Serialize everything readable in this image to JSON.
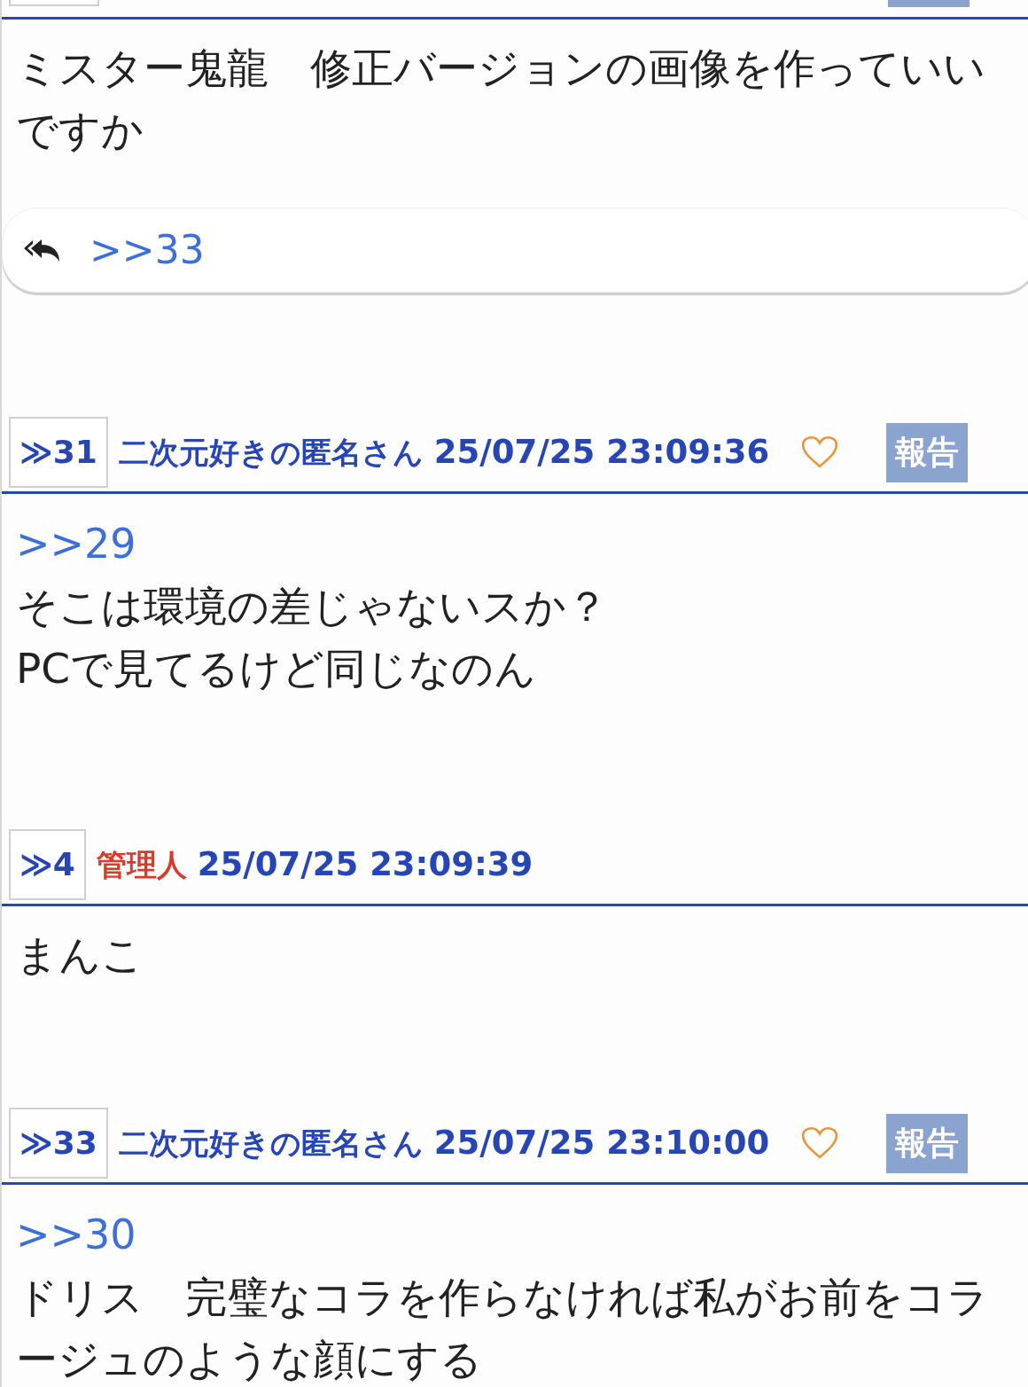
{
  "posts": [
    {
      "text": "ミスター鬼龍　修正バージョンの画像を作っていいですか",
      "reply": {
        "anchor": ">>33"
      }
    },
    {
      "header": {
        "number": "≫31",
        "author": "二次元好きの匿名さん",
        "admin": false,
        "date": "25/07/25 23:09:36",
        "heart": true,
        "report": "報告"
      },
      "anchor": ">>29",
      "text": "そこは環境の差じゃないスか？\nPCで見てるけど同じなのん"
    },
    {
      "header": {
        "number": "≫4",
        "author": "管理人",
        "admin": true,
        "date": "25/07/25 23:09:39",
        "heart": false
      },
      "text": "まんこ"
    },
    {
      "header": {
        "number": "≫33",
        "author": "二次元好きの匿名さん",
        "admin": false,
        "date": "25/07/25 23:10:00",
        "heart": true,
        "report": "報告"
      },
      "anchor": ">>30",
      "text": "ドリス　完璧なコラを作らなければ私がお前をコラージュのような顔にする"
    }
  ]
}
